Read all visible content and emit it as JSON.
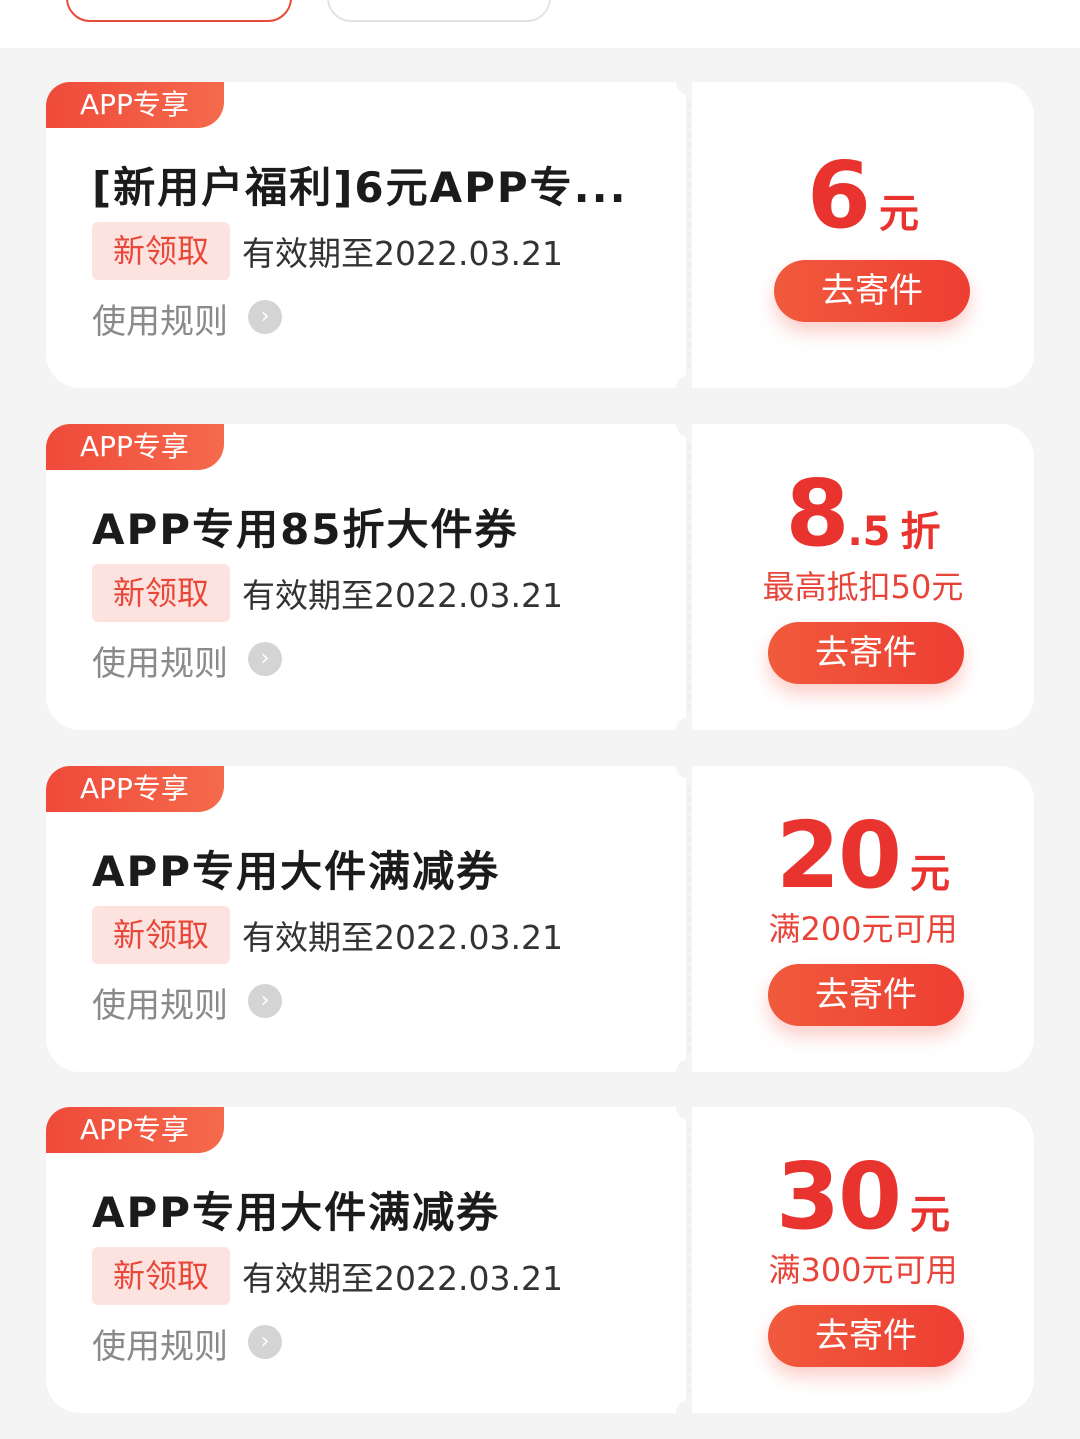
{
  "tabs": [
    {
      "label": "",
      "active": true
    },
    {
      "label": "",
      "active": false
    }
  ],
  "coupons": [
    {
      "tag": "APP专享",
      "title": "[新用户福利]6元APP专...",
      "badge": "新领取",
      "validity": "有效期至2022.03.21",
      "rules": "使用规则",
      "amount_int": "6",
      "amount_dec": "",
      "amount_unit": "元",
      "condition": "",
      "button": "去寄件"
    },
    {
      "tag": "APP专享",
      "title": "APP专用85折大件券",
      "badge": "新领取",
      "validity": "有效期至2022.03.21",
      "rules": "使用规则",
      "amount_int": "8",
      "amount_dec": ".5",
      "amount_unit": "折",
      "condition": "最高抵扣50元",
      "button": "去寄件"
    },
    {
      "tag": "APP专享",
      "title": "APP专用大件满减券",
      "badge": "新领取",
      "validity": "有效期至2022.03.21",
      "rules": "使用规则",
      "amount_int": "20",
      "amount_dec": "",
      "amount_unit": "元",
      "condition": "满200元可用",
      "button": "去寄件"
    },
    {
      "tag": "APP专享",
      "title": "APP专用大件满减券",
      "badge": "新领取",
      "validity": "有效期至2022.03.21",
      "rules": "使用规则",
      "amount_int": "30",
      "amount_dec": "",
      "amount_unit": "元",
      "condition": "满300元可用",
      "button": "去寄件"
    }
  ],
  "icons": {
    "rules": "chevron-right-circle-icon"
  },
  "colors": {
    "accent": "#e8332f",
    "badge_bg": "#fde3df",
    "page_bg": "#f4f4f4"
  }
}
